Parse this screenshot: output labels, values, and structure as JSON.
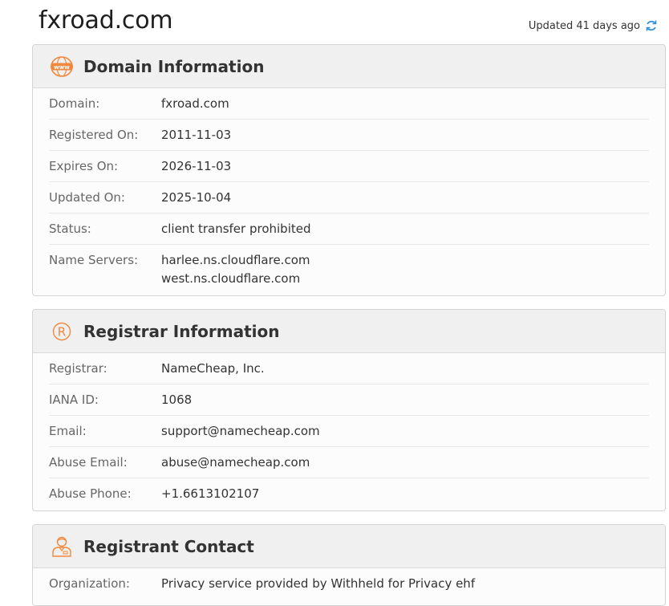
{
  "page": {
    "domain_title": "fxroad.com",
    "updated_text": "Updated 41 days ago"
  },
  "domain_info": {
    "title": "Domain Information",
    "icon": "www-globe-icon",
    "rows": {
      "domain": {
        "label": "Domain:",
        "value": "fxroad.com"
      },
      "registered": {
        "label": "Registered On:",
        "value": "2011-11-03"
      },
      "expires": {
        "label": "Expires On:",
        "value": "2026-11-03"
      },
      "updated": {
        "label": "Updated On:",
        "value": "2025-10-04"
      },
      "status": {
        "label": "Status:",
        "value": "client transfer prohibited"
      },
      "name_servers": {
        "label": "Name Servers:",
        "values": [
          "harlee.ns.cloudflare.com",
          "west.ns.cloudflare.com"
        ]
      }
    }
  },
  "registrar_info": {
    "title": "Registrar Information",
    "icon": "registered-mark-icon",
    "rows": {
      "registrar": {
        "label": "Registrar:",
        "value": "NameCheap, Inc."
      },
      "iana": {
        "label": "IANA ID:",
        "value": "1068"
      },
      "email": {
        "label": "Email:",
        "value": "support@namecheap.com"
      },
      "abuse_email": {
        "label": "Abuse Email:",
        "value": "abuse@namecheap.com"
      },
      "abuse_phone": {
        "label": "Abuse Phone:",
        "value": "+1.6613102107"
      }
    }
  },
  "registrant_contact": {
    "title": "Registrant Contact",
    "icon": "person-contact-icon",
    "rows": {
      "organization": {
        "label": "Organization:",
        "value": "Privacy service provided by Withheld for Privacy ehf"
      }
    }
  },
  "colors": {
    "accent": "#f0883e",
    "refresh": "#2f8fd8"
  }
}
